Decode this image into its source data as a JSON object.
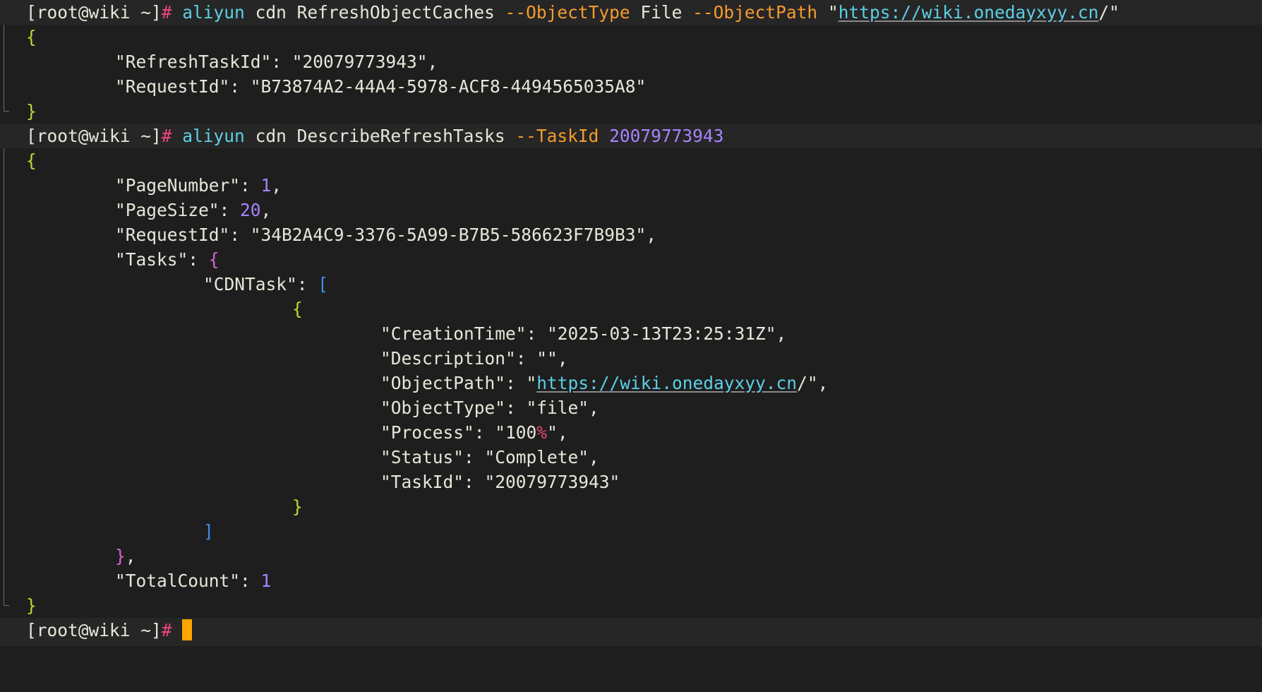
{
  "terminal": {
    "prompt": "[root@wiki ~]",
    "hash": "#",
    "cmd1": {
      "program": "aliyun",
      "args1": "cdn RefreshObjectCaches",
      "opt_type": "--ObjectType",
      "type_val": "File",
      "opt_path": "--ObjectPath",
      "quote_open": "\"",
      "url": "https://wiki.onedayxyy.cn",
      "url_tail": "/\""
    },
    "out1": {
      "refresh_task_id_key": "\"RefreshTaskId\"",
      "refresh_task_id_val": "\"20079773943\",",
      "request_id_key": "\"RequestId\"",
      "request_id_val": "\"B73874A2-44A4-5978-ACF8-4494565035A8\""
    },
    "cmd2": {
      "program": "aliyun",
      "args": "cdn DescribeRefreshTasks",
      "opt_task": "--TaskId",
      "task_val": "20079773943"
    },
    "out2": {
      "page_number_key": "\"PageNumber\"",
      "page_number_val": "1",
      "page_size_key": "\"PageSize\"",
      "page_size_val": "20",
      "request_id_key": "\"RequestId\"",
      "request_id_val": "\"34B2A4C9-3376-5A99-B7B5-586623F7B9B3\",",
      "tasks_key": "\"Tasks\"",
      "cdntask_key": "\"CDNTask\"",
      "creation_time_key": "\"CreationTime\"",
      "creation_time_val": "\"2025-03-13T23:25:31Z\",",
      "description_key": "\"Description\"",
      "description_val": "\"\",",
      "object_path_key": "\"ObjectPath\"",
      "object_path_q": "\"",
      "object_path_url": "https://wiki.onedayxyy.cn",
      "object_path_tail": "/\",",
      "object_type_key": "\"ObjectType\"",
      "object_type_val": "\"file\",",
      "process_key": "\"Process\"",
      "process_val_pre": "\"100",
      "process_pct": "%",
      "process_val_post": "\",",
      "status_key": "\"Status\"",
      "status_val": "\"Complete\",",
      "taskid_key": "\"TaskId\"",
      "taskid_val": "\"20079773943\"",
      "total_count_key": "\"TotalCount\"",
      "total_count_val": "1"
    },
    "colors": {
      "background": "#1e1e1e",
      "prompt_hash": "#f0467a",
      "command": "#5ccfe6",
      "option": "#f59b2b",
      "number": "#a882ff",
      "brace": "#b5dc30",
      "cursor": "#ffa500"
    }
  }
}
